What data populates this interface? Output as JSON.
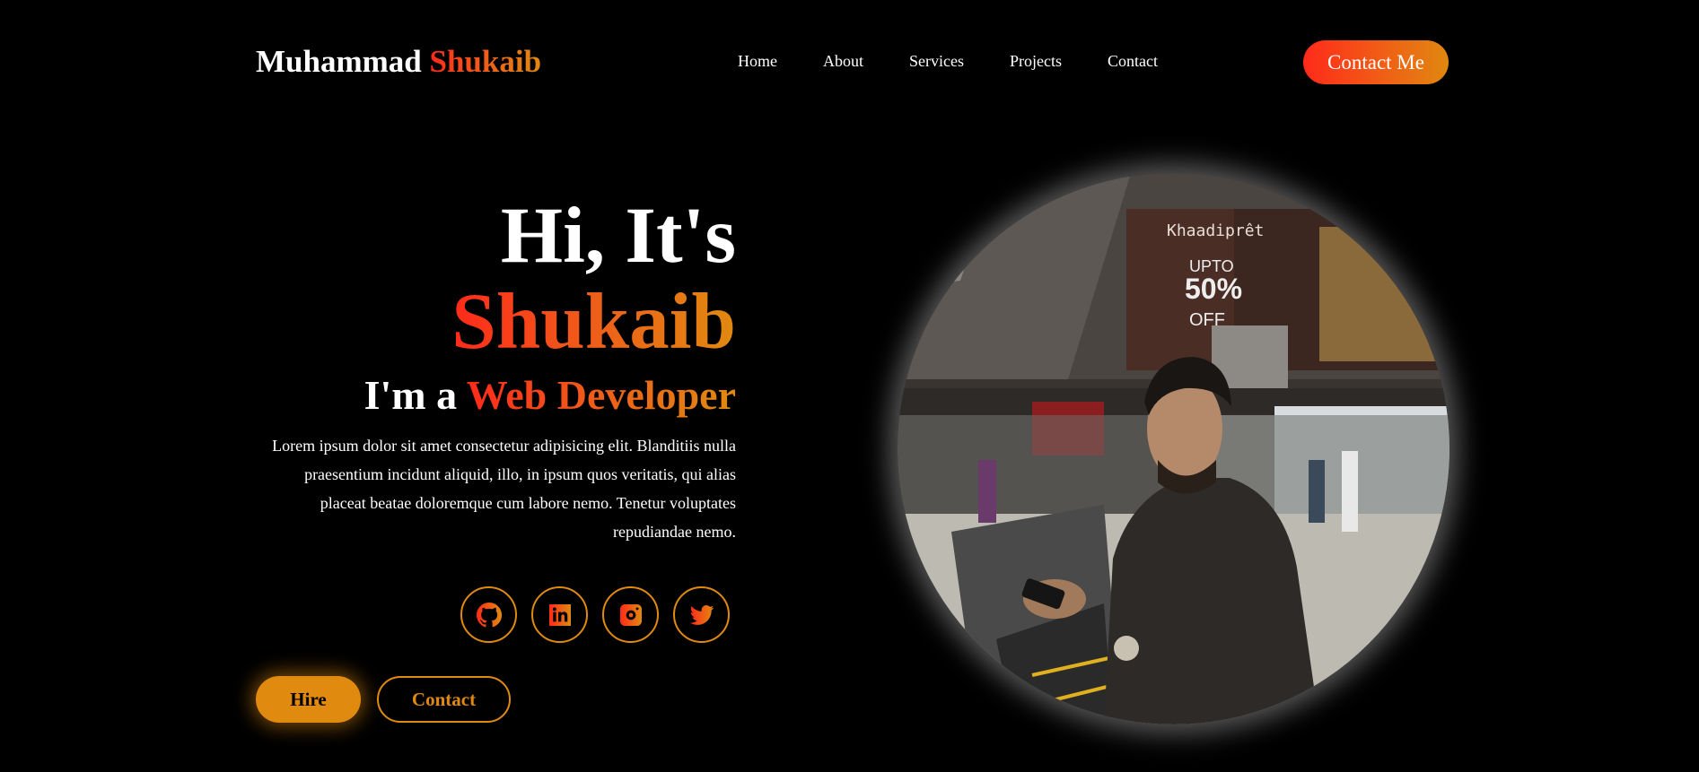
{
  "header": {
    "brand_first": "Muhammad",
    "brand_last": "Shukaib",
    "nav": [
      "Home",
      "About",
      "Services",
      "Projects",
      "Contact"
    ],
    "cta_label": "Contact Me"
  },
  "hero": {
    "greeting": "Hi, It's",
    "name": "Shukaib",
    "role_prefix": "I'm a",
    "role": "Web Developer",
    "description": "Lorem ipsum dolor sit amet consectetur adipisicing elit. Blanditiis nulla praesentium incidunt aliquid, illo, in ipsum quos veritatis, qui alias placeat beatae doloremque cum labore nemo. Tenetur voluptates repudiandae nemo."
  },
  "socials": [
    {
      "icon": "github-icon"
    },
    {
      "icon": "linkedin-icon"
    },
    {
      "icon": "instagram-icon"
    },
    {
      "icon": "twitter-icon"
    }
  ],
  "buttons": {
    "hire": "Hire",
    "contact": "Contact"
  },
  "portrait": {
    "sign_brand": "Khaadiprêt",
    "sign_upto": "UPTO",
    "sign_percent": "50%",
    "sign_off": "OFF"
  },
  "colors": {
    "background": "#000000",
    "accent_orange": "#e08a10",
    "accent_red": "#ff2a1a"
  }
}
